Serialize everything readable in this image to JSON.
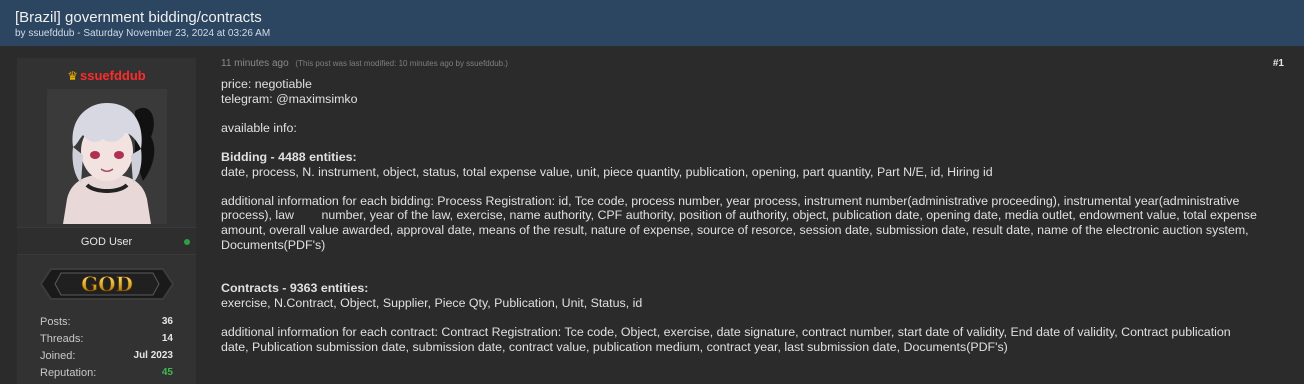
{
  "thread": {
    "title": "[Brazil] government bidding/contracts",
    "meta": "by ssuefddub - Saturday November 23, 2024 at 03:26 AM"
  },
  "user": {
    "username": "ssuefddub",
    "crown_icon": "crown-icon",
    "title": "GOD User",
    "rank_badge": "GOD",
    "online": true,
    "stats": [
      {
        "label": "Posts:",
        "value": "36"
      },
      {
        "label": "Threads:",
        "value": "14"
      },
      {
        "label": "Joined:",
        "value": "Jul 2023"
      },
      {
        "label": "Reputation:",
        "value": "45",
        "color": "#3fb950"
      }
    ]
  },
  "post": {
    "time": "11 minutes ago",
    "edited": "(This post was last modified: 10 minutes ago by ssuefddub.)",
    "number": "#1",
    "lines": {
      "price": "price: negotiable",
      "telegram": "telegram: @maximsimko",
      "available": "available info:",
      "bidding_head": "Bidding - 4488 entities:",
      "bidding_fields": "date, process, N. instrument, object, status, total expense value, unit, piece quantity, publication, opening, part quantity, Part N/E, id, Hiring id",
      "bidding_additional": [
        "additional information for each bidding: Process Registration: id, Tce code, process number, year process, instrument number(administrative proceeding), instrumental year(administrative",
        "process), law        number, year of the law, exercise, name authority, CPF authority, position of authority, object, publication date, opening date, media outlet, endowment value, total expense",
        "amount, overall value awarded, approval date, means of the result, nature of expense, source of resorce, session date, submission date, result date, name of the electronic auction system,",
        "Documents(PDF's)"
      ],
      "contracts_head": "Contracts - 9363 entities:",
      "contracts_fields": "exercise, N.Contract, Object, Supplier, Piece Qty, Publication, Unit, Status, id",
      "contracts_additional": [
        "additional information for each contract: Contract Registration: Tce code, Object, exercise, date signature, contract number, start date of validity, End date of validity, Contract publication",
        "date, Publication submission date, submission date, contract value, publication medium, contract year, last submission date, Documents(PDF's)"
      ]
    }
  }
}
